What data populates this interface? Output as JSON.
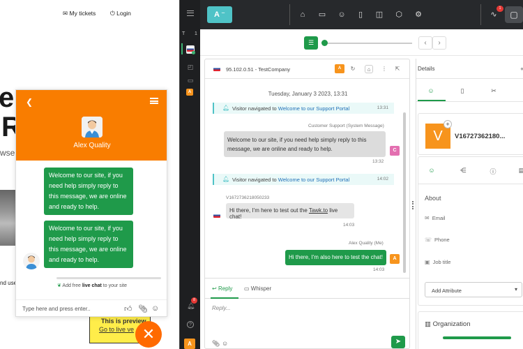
{
  "website": {
    "nav": {
      "tickets": "My tickets",
      "login": "Login"
    },
    "bg_letters": [
      "e",
      "R"
    ],
    "bg_text": "wse",
    "bg_text2": "nd use",
    "preview": {
      "title": "This is preview",
      "link": "Go to live ve"
    }
  },
  "widget": {
    "agent_name": "Alex Quality",
    "messages": [
      "Welcome to our site, if you need help simply reply to this message, we are online and ready to help.",
      "Welcome to our site, if you need help simply reply to this message, we are online and ready to help."
    ],
    "footer_pre": "Add free ",
    "footer_bold": "live chat",
    "footer_post": " to your site",
    "input_placeholder": "Type here and press enter.."
  },
  "sidebar": {
    "tab_letter": "T",
    "tab_count": "1",
    "agent_badge": "A",
    "notif_count": "8",
    "bottom_badge": "A"
  },
  "topbar": {
    "logo": "A",
    "activity_count": "1"
  },
  "chat": {
    "title": "95.102.0.51 - TestCompany",
    "date": "Tuesday, January 3 2023, 13:31",
    "events": [
      {
        "text_pre": "Visitor navigated to ",
        "link": "Welcome to our Support Portal",
        "time": "13:31"
      },
      {
        "text_pre": "Visitor navigated to ",
        "link": "Welcome to our Support Portal",
        "time": "14:02"
      }
    ],
    "agent_label": "Customer Support (System Message)",
    "agent_message": "Welcome to our site, if you need help simply reply to this message, we are online and ready to help.",
    "agent_time": "13:32",
    "agent_avatar": "C",
    "visitor_label": "V1672736218050233",
    "visitor_message_pre": "Hi there, I'm here to test out the ",
    "visitor_message_link": "Tawk.to",
    "visitor_message_post": " live chat!",
    "visitor_time": "14:03",
    "me_label": "Alex Quality (Me)",
    "me_message": "Hi there, I'm also here to test the chat!",
    "me_time": "14:03",
    "me_avatar": "A",
    "header_badge": "A",
    "tabs": {
      "reply": "Reply",
      "whisper": "Whisper"
    },
    "reply_placeholder": "Reply..."
  },
  "details": {
    "title": "Details",
    "visitor_initial": "V",
    "visitor_name": "V16727362180...",
    "about": "About",
    "fields": [
      "Email",
      "Phone",
      "Job title"
    ],
    "add_attribute": "Add Attribute",
    "organization": "Organization"
  },
  "colors": {
    "orange": "#f97d00",
    "green": "#1f9a4a",
    "teal": "#4fc3c7",
    "dark": "#27292c"
  }
}
